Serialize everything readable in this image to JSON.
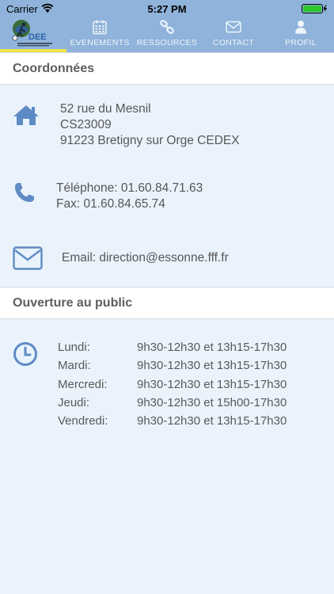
{
  "status": {
    "carrier": "Carrier",
    "time": "5:27 PM"
  },
  "nav": {
    "logo_text": "DEE",
    "tabs": [
      {
        "label": "EVENEMENTS",
        "icon": "calendar-icon"
      },
      {
        "label": "RESSOURCES",
        "icon": "link-icon"
      },
      {
        "label": "CONTACT",
        "icon": "envelope-icon"
      },
      {
        "label": "PROFIL",
        "icon": "person-icon"
      }
    ]
  },
  "coordonnees": {
    "title": "Coordonnées",
    "address": {
      "icon": "home-icon",
      "line1": "52 rue du Mesnil",
      "line2": "CS23009",
      "line3": "91223 Bretigny sur Orge CEDEX"
    },
    "phone": {
      "icon": "phone-icon",
      "telephone": "Téléphone: 01.60.84.71.63",
      "fax": "Fax: 01.60.84.65.74"
    },
    "email": {
      "icon": "envelope-icon",
      "text": "Email: direction@essonne.fff.fr"
    }
  },
  "ouverture": {
    "title": "Ouverture au public",
    "icon": "clock-icon",
    "days": [
      {
        "day": "Lundi:",
        "hours": "9h30-12h30 et 13h15-17h30"
      },
      {
        "day": "Mardi:",
        "hours": "9h30-12h30 et 13h15-17h30"
      },
      {
        "day": "Mercredi:",
        "hours": "9h30-12h30 et 13h15-17h30"
      },
      {
        "day": "Jeudi:",
        "hours": "9h30-12h30 et 15h00-17h30"
      },
      {
        "day": "Vendredi:",
        "hours": "9h30-12h30 et 13h15-17h30"
      }
    ]
  },
  "colors": {
    "nav_bg": "#8fb3da",
    "accent": "#f1e44d",
    "icon_blue": "#5e8bc4",
    "page_bg": "#eaf3fc"
  }
}
